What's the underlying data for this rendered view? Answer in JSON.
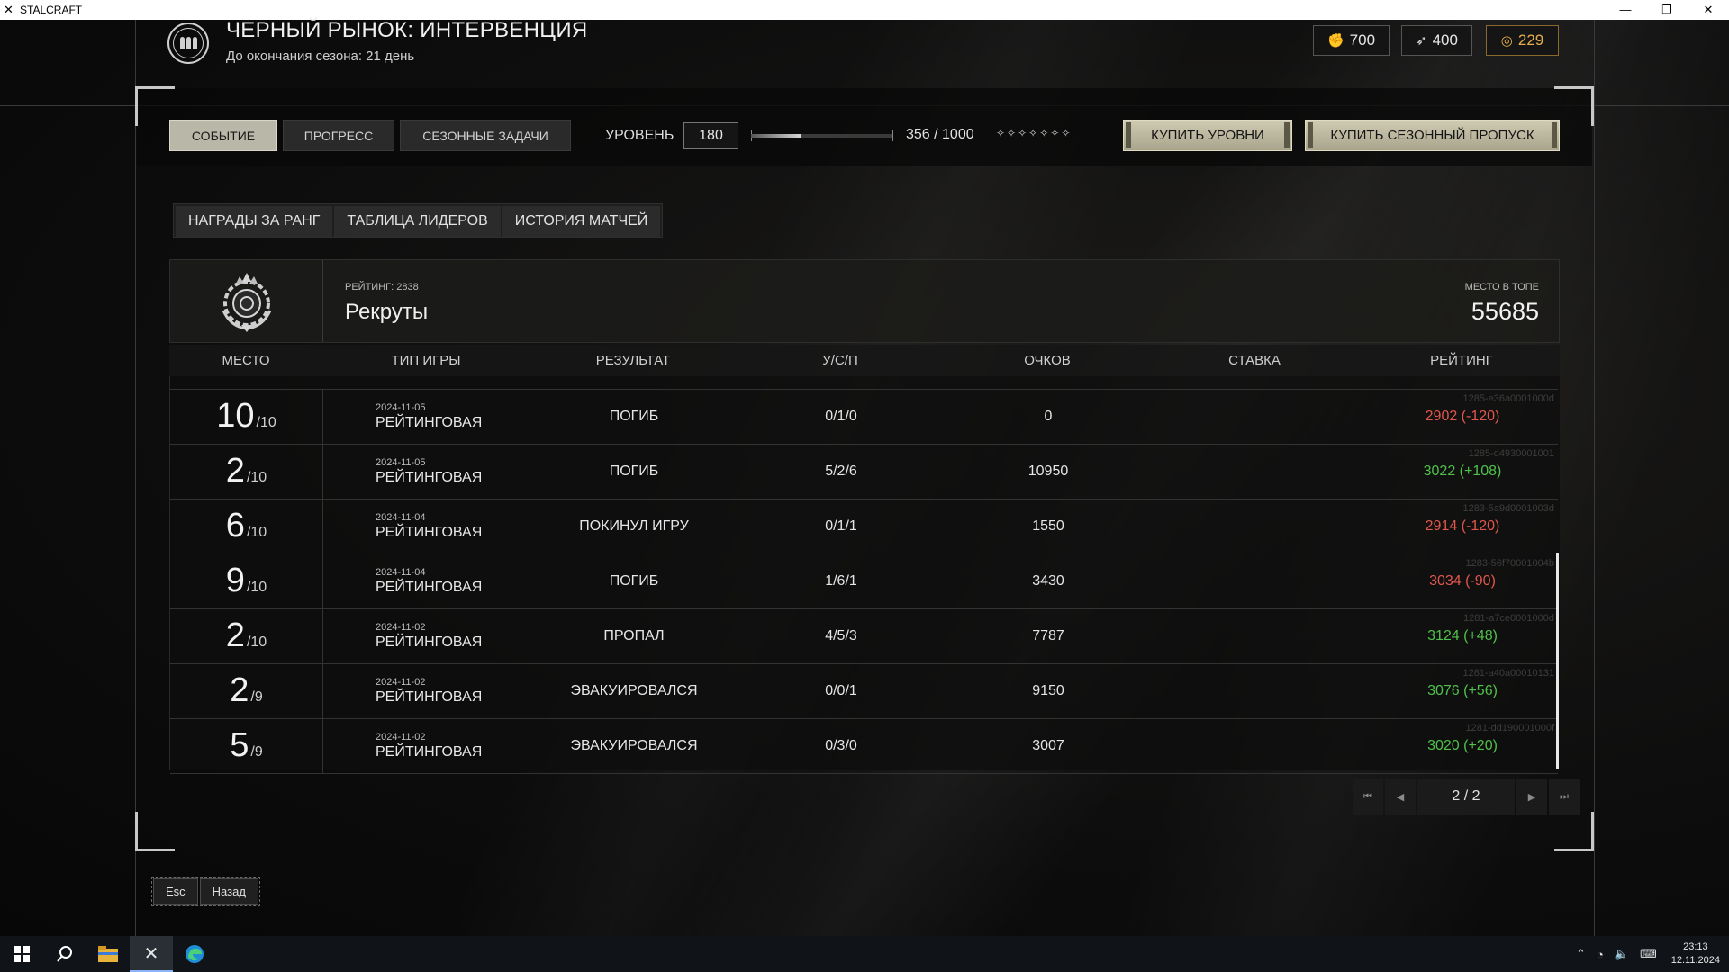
{
  "window": {
    "title": "STALCRAFT",
    "controls": [
      "—",
      "❐",
      "✕"
    ]
  },
  "header": {
    "title": "ЧЕРНЫЙ РЫНОК: ИНТЕРВЕНЦИЯ",
    "subtitle": "До окончания сезона: 21 день"
  },
  "currencies": [
    {
      "icon": "fist-token-icon",
      "value": "700"
    },
    {
      "icon": "bullet-token-icon",
      "value": "400"
    },
    {
      "icon": "gold-coin-icon",
      "value": "229"
    }
  ],
  "main_tabs": [
    {
      "label": "СОБЫТИЕ",
      "active": true
    },
    {
      "label": "ПРОГРЕСС",
      "active": false
    },
    {
      "label": "СЕЗОННЫЕ ЗАДАЧИ",
      "active": false
    }
  ],
  "level": {
    "label": "УРОВЕНЬ",
    "value": "180",
    "progress_text": "356 / 1000",
    "progress_fraction": 0.356,
    "stars": "✧✧✧✧✧✧✧"
  },
  "buy": {
    "levels_label": "КУПИТЬ УРОВНИ",
    "pass_label": "КУПИТЬ СЕЗОННЫЙ ПРОПУСК"
  },
  "sub_tabs": [
    "НАГРАДЫ ЗА РАНГ",
    "ТАБЛИЦА ЛИДЕРОВ",
    "ИСТОРИЯ МАТЧЕЙ"
  ],
  "rank": {
    "rating_label": "РЕЙТИНГ: 2838",
    "name": "Рекруты",
    "top_label": "МЕСТО В ТОПЕ",
    "top_value": "55685"
  },
  "table": {
    "columns": [
      "МЕСТО",
      "ТИП ИГРЫ",
      "РЕЗУЛЬТАТ",
      "У/С/П",
      "ОЧКОВ",
      "СТАВКА",
      "РЕЙТИНГ"
    ],
    "rows": [
      {
        "place": "10",
        "of": "/10",
        "date": "2024-11-05",
        "mode": "РЕЙТИНГОВАЯ",
        "result": "ПОГИБ",
        "ksd": "0/1/0",
        "points": "0",
        "bet": "",
        "rating": "2902 (-120)",
        "delta": "neg",
        "match_id": "1285-e36a0001000d"
      },
      {
        "place": "2",
        "of": "/10",
        "date": "2024-11-05",
        "mode": "РЕЙТИНГОВАЯ",
        "result": "ПОГИБ",
        "ksd": "5/2/6",
        "points": "10950",
        "bet": "",
        "rating": "3022 (+108)",
        "delta": "pos",
        "match_id": "1285-d4930001001"
      },
      {
        "place": "6",
        "of": "/10",
        "date": "2024-11-04",
        "mode": "РЕЙТИНГОВАЯ",
        "result": "ПОКИНУЛ ИГРУ",
        "ksd": "0/1/1",
        "points": "1550",
        "bet": "",
        "rating": "2914 (-120)",
        "delta": "neg",
        "match_id": "1283-5a9d0001003d"
      },
      {
        "place": "9",
        "of": "/10",
        "date": "2024-11-04",
        "mode": "РЕЙТИНГОВАЯ",
        "result": "ПОГИБ",
        "ksd": "1/6/1",
        "points": "3430",
        "bet": "",
        "rating": "3034 (-90)",
        "delta": "neg",
        "match_id": "1283-56f70001004b"
      },
      {
        "place": "2",
        "of": "/10",
        "date": "2024-11-02",
        "mode": "РЕЙТИНГОВАЯ",
        "result": "ПРОПАЛ",
        "ksd": "4/5/3",
        "points": "7787",
        "bet": "",
        "rating": "3124 (+48)",
        "delta": "pos",
        "match_id": "1281-a7ce0001000d"
      },
      {
        "place": "2",
        "of": "/9",
        "date": "2024-11-02",
        "mode": "РЕЙТИНГОВАЯ",
        "result": "ЭВАКУИРОВАЛСЯ",
        "ksd": "0/0/1",
        "points": "9150",
        "bet": "",
        "rating": "3076 (+56)",
        "delta": "pos",
        "match_id": "1281-a40a00010131"
      },
      {
        "place": "5",
        "of": "/9",
        "date": "2024-11-02",
        "mode": "РЕЙТИНГОВАЯ",
        "result": "ЭВАКУИРОВАЛСЯ",
        "ksd": "0/3/0",
        "points": "3007",
        "bet": "",
        "rating": "3020 (+20)",
        "delta": "pos",
        "match_id": "1281-dd190001000f"
      }
    ]
  },
  "pager": {
    "text": "2 / 2",
    "first": "⏮",
    "prev": "◀",
    "next": "▶",
    "last": "⏭"
  },
  "bottom": {
    "esc_label": "Esc",
    "back_label": "Назад"
  },
  "taskbar": {
    "time": "23:13",
    "date": "12.11.2024",
    "colors": {
      "accent": "#8ab4f8",
      "neg": "#e2574c",
      "pos": "#4fc24a",
      "gold": "#e7b04a"
    }
  }
}
